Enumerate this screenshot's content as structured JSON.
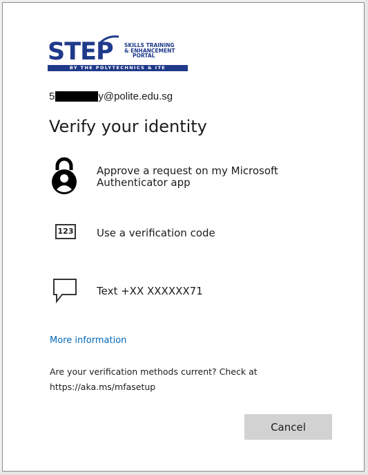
{
  "logo": {
    "word": "STEP",
    "tagline_lines": [
      "SKILLS TRAINING",
      "& ENHANCEMENT",
      "PORTAL"
    ],
    "bar_text": "BY THE POLYTECHNICS & ITE",
    "brand_color": "#1f3a8a"
  },
  "account": {
    "email_prefix": "5",
    "email_suffix": "y@polite.edu.sg"
  },
  "page": {
    "title": "Verify your identity"
  },
  "options": {
    "authenticator": {
      "label": "Approve a request on my Microsoft Authenticator app",
      "icon": "lock-person-icon"
    },
    "code": {
      "label": "Use a verification code",
      "icon_text": "123",
      "icon": "code-box-icon"
    },
    "sms": {
      "label": "Text +XX XXXXXX71",
      "icon": "chat-bubble-icon"
    }
  },
  "links": {
    "more_info": "More information"
  },
  "notice": {
    "text": "Are your verification methods current? Check at https://aka.ms/mfasetup"
  },
  "buttons": {
    "cancel": "Cancel"
  },
  "colors": {
    "link": "#0067b8",
    "button_bg": "#d2d2d2"
  }
}
